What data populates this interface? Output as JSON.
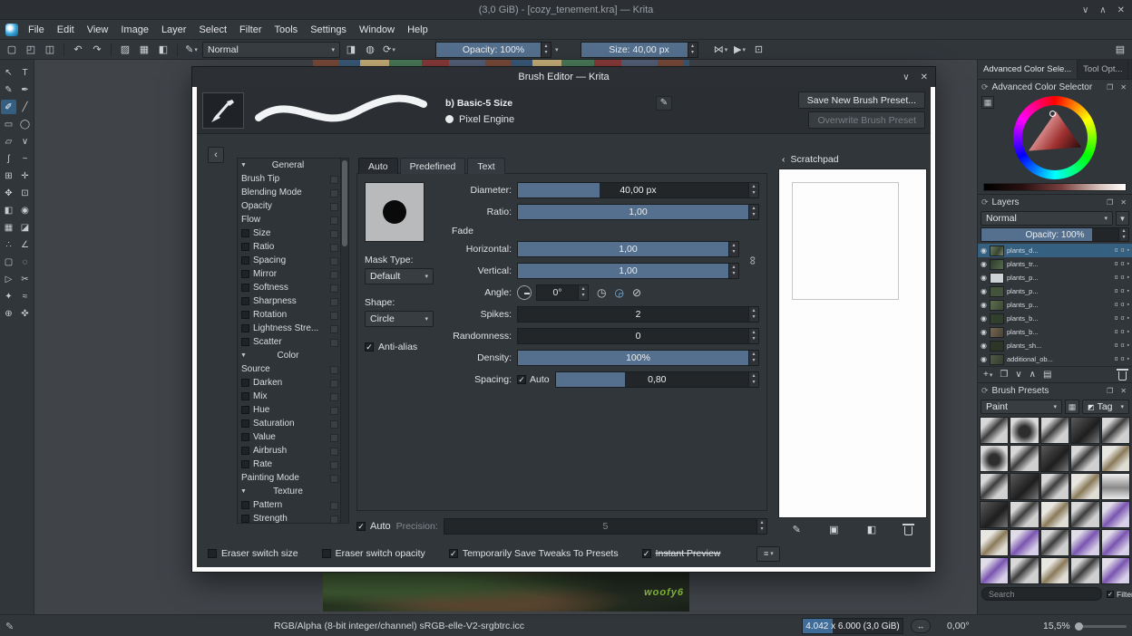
{
  "window": {
    "title": "(3,0 GiB) - [cozy_tenement.kra] — Krita"
  },
  "icons": {
    "minimize": "∨",
    "maximize": "∧",
    "close": "✕",
    "new_doc": "▢",
    "open_doc": "◰",
    "save_doc": "◫",
    "undo": "↶",
    "redo": "↷",
    "gradient": "▨",
    "pattern": "▦",
    "fg_bg": "◧",
    "preset_chooser": "✎",
    "eraser": "◨",
    "alpha": "◍",
    "reload": "⟳",
    "mirror_h": "⋈",
    "mirror_v": "▶",
    "trim": "⊡",
    "workspace": "▤",
    "dialog_shade": "∨",
    "dialog_close": "✕",
    "collapse": "‹",
    "edit_pencil": "✎",
    "chain": "∞",
    "dial_cw": "◷",
    "dial_ccw": "◶",
    "dial_off": "⊘",
    "scratch_back": "‹",
    "scratch_brush": "✎",
    "scratch_display": "▣",
    "scratch_fill": "◧",
    "docker_icon": "⟳",
    "docker_float": "❐",
    "docker_close": "✕",
    "selector_config": "▦",
    "funnel": "▼",
    "tag": "◩",
    "eye": "◉",
    "alpha_inherit": "ɑ",
    "alpha_lock": "α",
    "layer_lock": "▪",
    "add": "+",
    "dropdown": "▾",
    "duplicate": "❐",
    "down": "∨",
    "up": "∧",
    "props": "▤",
    "pan_status": "↔",
    "status_tool": "✎",
    "menu_list": "≡"
  },
  "menubar": {
    "items": [
      {
        "label": "File"
      },
      {
        "label": "Edit"
      },
      {
        "label": "View"
      },
      {
        "label": "Image"
      },
      {
        "label": "Layer"
      },
      {
        "label": "Select"
      },
      {
        "label": "Filter"
      },
      {
        "label": "Tools"
      },
      {
        "label": "Settings"
      },
      {
        "label": "Window"
      },
      {
        "label": "Help"
      }
    ]
  },
  "toolbar": {
    "blend_mode": "Normal",
    "opacity": "Opacity: 100%",
    "opacity_fill": 100,
    "size": "Size: 40,00 px",
    "size_fill": 100
  },
  "tools": [
    {
      "g": "↖",
      "n": "select-shapes-tool",
      "cls": ""
    },
    {
      "g": "T",
      "n": "text-tool",
      "cls": ""
    },
    {
      "g": "✎",
      "n": "edit-shapes-tool",
      "cls": ""
    },
    {
      "g": "✒",
      "n": "calligraphy-tool",
      "cls": ""
    },
    {
      "g": "✐",
      "n": "freehand-brush-tool",
      "cls": "active"
    },
    {
      "g": "╱",
      "n": "line-tool",
      "cls": ""
    },
    {
      "g": "▭",
      "n": "rectangle-tool",
      "cls": ""
    },
    {
      "g": "◯",
      "n": "ellipse-tool",
      "cls": ""
    },
    {
      "g": "▱",
      "n": "polygon-tool",
      "cls": ""
    },
    {
      "g": "∨",
      "n": "polyline-tool",
      "cls": ""
    },
    {
      "g": "ʃ",
      "n": "bezier-curve-tool",
      "cls": ""
    },
    {
      "g": "~",
      "n": "dynamic-brush-tool",
      "cls": ""
    },
    {
      "g": "⊞",
      "n": "multibrush-tool",
      "cls": ""
    },
    {
      "g": "✛",
      "n": "transform-tool",
      "cls": ""
    },
    {
      "g": "✥",
      "n": "move-tool",
      "cls": ""
    },
    {
      "g": "⊡",
      "n": "crop-tool",
      "cls": ""
    },
    {
      "g": "◧",
      "n": "gradient-tool",
      "cls": ""
    },
    {
      "g": "◉",
      "n": "color-sampler-tool",
      "cls": ""
    },
    {
      "g": "▦",
      "n": "pattern-edit-tool",
      "cls": ""
    },
    {
      "g": "◪",
      "n": "fill-tool",
      "cls": ""
    },
    {
      "g": "∴",
      "n": "assistants-tool",
      "cls": ""
    },
    {
      "g": "∠",
      "n": "measure-tool",
      "cls": ""
    },
    {
      "g": "▢",
      "n": "rect-select-tool",
      "cls": ""
    },
    {
      "g": "◌",
      "n": "ellipse-select-tool",
      "cls": ""
    },
    {
      "g": "▷",
      "n": "polygon-select-tool",
      "cls": ""
    },
    {
      "g": "✂",
      "n": "freehand-select-tool",
      "cls": ""
    },
    {
      "g": "✦",
      "n": "contiguous-select-tool",
      "cls": ""
    },
    {
      "g": "≈",
      "n": "similar-select-tool",
      "cls": ""
    },
    {
      "g": "⊕",
      "n": "zoom-tool",
      "cls": ""
    },
    {
      "g": "✜",
      "n": "pan-tool",
      "cls": ""
    }
  ],
  "canvas": {
    "signature": "woofy6"
  },
  "dialog": {
    "title": "Brush Editor — Krita",
    "preset_name": "b) Basic-5 Size",
    "engine_label": "Pixel Engine",
    "save_new": "Save New Brush Preset...",
    "overwrite": "Overwrite Brush Preset",
    "options": [
      {
        "label": "General",
        "type": "header"
      },
      {
        "label": "Brush Tip",
        "type": "plain"
      },
      {
        "label": "Blending Mode",
        "type": "plain"
      },
      {
        "label": "Opacity",
        "type": "plain"
      },
      {
        "label": "Flow",
        "type": "plain"
      },
      {
        "label": "Size",
        "type": "checked"
      },
      {
        "label": "Ratio",
        "type": "unchecked"
      },
      {
        "label": "Spacing",
        "type": "unchecked"
      },
      {
        "label": "Mirror",
        "type": "unchecked"
      },
      {
        "label": "Softness",
        "type": "unchecked"
      },
      {
        "label": "Sharpness",
        "type": "unchecked"
      },
      {
        "label": "Rotation",
        "type": "unchecked"
      },
      {
        "label": "Lightness Stre...",
        "type": "unchecked"
      },
      {
        "label": "Scatter",
        "type": "unchecked"
      },
      {
        "label": "Color",
        "type": "header"
      },
      {
        "label": "Source",
        "type": "plain"
      },
      {
        "label": "Darken",
        "type": "unchecked"
      },
      {
        "label": "Mix",
        "type": "unchecked"
      },
      {
        "label": "Hue",
        "type": "unchecked"
      },
      {
        "label": "Saturation",
        "type": "unchecked"
      },
      {
        "label": "Value",
        "type": "unchecked"
      },
      {
        "label": "Airbrush",
        "type": "unchecked"
      },
      {
        "label": "Rate",
        "type": "unchecked"
      },
      {
        "label": "Painting Mode",
        "type": "plain"
      },
      {
        "label": "Texture",
        "type": "header"
      },
      {
        "label": "Pattern",
        "type": "unchecked"
      },
      {
        "label": "Strength",
        "type": "unchecked"
      }
    ],
    "tabs": {
      "auto": "Auto",
      "predefined": "Predefined",
      "text": "Text"
    },
    "fields": {
      "diameter_label": "Diameter:",
      "diameter_value": "40,00 px",
      "ratio_label": "Ratio:",
      "ratio_value": "1,00",
      "fade_label": "Fade",
      "horizontal_label": "Horizontal:",
      "horizontal_value": "1,00",
      "vertical_label": "Vertical:",
      "vertical_value": "1,00",
      "mask_type_label": "Mask Type:",
      "mask_type_value": "Default",
      "shape_label": "Shape:",
      "shape_value": "Circle",
      "angle_label": "Angle:",
      "angle_value": "0°",
      "antialias_label": "Anti-alias",
      "spikes_label": "Spikes:",
      "spikes_value": "2",
      "randomness_label": "Randomness:",
      "randomness_value": "0",
      "density_label": "Density:",
      "density_value": "100%",
      "spacing_label": "Spacing:",
      "spacing_auto_label": "Auto",
      "spacing_value": "0,80",
      "auto_label": "Auto",
      "precision_label": "Precision:",
      "precision_value": "5"
    },
    "sliders": {
      "diameter": 34,
      "ratio": 100,
      "horizontal": 100,
      "vertical": 100,
      "spikes": 0,
      "randomness": 0,
      "density": 100,
      "spacing": 34,
      "precision": 0
    },
    "footer": {
      "eraser_size": "Eraser switch size",
      "eraser_opacity": "Eraser switch opacity",
      "save_tweaks": "Temporarily Save Tweaks To Presets",
      "instant_preview": "Instant Preview"
    },
    "scratchpad": {
      "title": "Scratchpad"
    }
  },
  "dockers": {
    "tab_color": "Advanced Color Sele...",
    "tab_tool": "Tool Opt...",
    "color_selector": {
      "title": "Advanced Color Selector"
    },
    "layers": {
      "title": "Layers",
      "blend_mode": "Normal",
      "opacity": "Opacity: 100%",
      "opacity_fill": 75,
      "rows": [
        {
          "name": "plants_d...",
          "cls": "selected",
          "t": "t1"
        },
        {
          "name": "plants_tr...",
          "cls": "",
          "t": "t2"
        },
        {
          "name": "plants_p...",
          "cls": "",
          "t": "t3"
        },
        {
          "name": "plants_p...",
          "cls": "",
          "t": "t4"
        },
        {
          "name": "plants_p...",
          "cls": "",
          "t": "t5"
        },
        {
          "name": "plants_b...",
          "cls": "",
          "t": "t6"
        },
        {
          "name": "plants_b...",
          "cls": "",
          "t": "t7"
        },
        {
          "name": "plants_sh...",
          "cls": "",
          "t": "t8"
        },
        {
          "name": "additional_ob...",
          "cls": "",
          "t": "t9"
        }
      ]
    },
    "presets": {
      "title": "Brush Presets",
      "paint": "Paint",
      "tag": "Tag",
      "search_placeholder": "Search",
      "filter_label": "Filter in Tag",
      "thumbs": [
        {
          "cls": "s1"
        },
        {
          "cls": "s2"
        },
        {
          "cls": "s1"
        },
        {
          "cls": "s6"
        },
        {
          "cls": "s1"
        },
        {
          "cls": "s2"
        },
        {
          "cls": "s1"
        },
        {
          "cls": "s6"
        },
        {
          "cls": "s1"
        },
        {
          "cls": "s3"
        },
        {
          "cls": "s1"
        },
        {
          "cls": "s6"
        },
        {
          "cls": "s1"
        },
        {
          "cls": "s3"
        },
        {
          "cls": "s5"
        },
        {
          "cls": "s6"
        },
        {
          "cls": "s1"
        },
        {
          "cls": "s3"
        },
        {
          "cls": "s1"
        },
        {
          "cls": "s4"
        },
        {
          "cls": "s3"
        },
        {
          "cls": "s4"
        },
        {
          "cls": "s1"
        },
        {
          "cls": "s4"
        },
        {
          "cls": "s4"
        },
        {
          "cls": "s4"
        },
        {
          "cls": "s1"
        },
        {
          "cls": "s3"
        },
        {
          "cls": "s1"
        },
        {
          "cls": "s4"
        }
      ]
    }
  },
  "statusbar": {
    "profile": "RGB/Alpha (8-bit integer/channel)  sRGB-elle-V2-srgbtrc.icc",
    "dims": "4.042 x 6.000 (3,0 GiB)",
    "mem_fill": 30,
    "angle": "0,00°",
    "zoom": "15,5%",
    "zoom_fill": 12
  },
  "colors": {
    "accent": "#3daee9",
    "slider_fill": "#54708e",
    "selection": "#35607f",
    "panel": "#31363b"
  }
}
